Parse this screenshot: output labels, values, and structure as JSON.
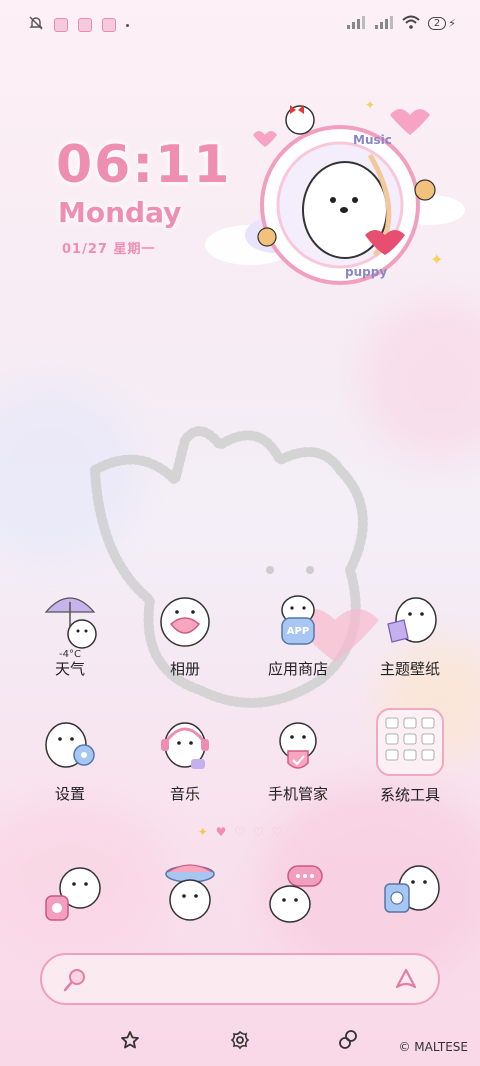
{
  "status_bar": {
    "battery_level": "2",
    "colors": {
      "icon": "#555555"
    }
  },
  "clock": {
    "time": "06:11",
    "day": "Monday",
    "date": "01/27 星期一",
    "color": "#ee8fb2"
  },
  "widget": {
    "ring_text_top": "Music",
    "ring_text_bottom": "puppy"
  },
  "apps_row1": [
    {
      "label": "天气",
      "icon": "weather-umbrella-bear-icon",
      "temp": "-4°C"
    },
    {
      "label": "相册",
      "icon": "gallery-bear-icon"
    },
    {
      "label": "应用商店",
      "icon": "app-store-bear-icon",
      "badge": "APP"
    },
    {
      "label": "主题壁纸",
      "icon": "theme-bear-icon"
    }
  ],
  "apps_row2": [
    {
      "label": "设置",
      "icon": "settings-bear-icon"
    },
    {
      "label": "音乐",
      "icon": "music-bear-icon"
    },
    {
      "label": "手机管家",
      "icon": "phone-manager-bear-icon"
    },
    {
      "label": "系统工具",
      "icon": "system-tools-folder-icon"
    }
  ],
  "page_indicator": {
    "pages": 5,
    "current": 1
  },
  "dock": [
    {
      "icon": "phone-bear-icon"
    },
    {
      "icon": "browser-bear-icon"
    },
    {
      "icon": "messages-bear-icon"
    },
    {
      "icon": "camera-bear-icon"
    }
  ],
  "search": {
    "left_icon": "search-icon",
    "right_icon": "voice-assistant-icon"
  },
  "navbar": {
    "buttons": [
      "home-flower-icon",
      "recent-flower-icon",
      "back-hearts-icon"
    ]
  },
  "copyright": "© MALTESE"
}
